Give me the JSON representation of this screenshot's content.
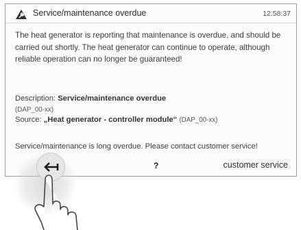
{
  "header": {
    "title": "Service/maintenance overdue",
    "time": "12:58:37",
    "icon": "warning-wrench-icon"
  },
  "message": "The heat generator is reporting that maintenance is overdue, and should be carried out shortly. The heat generator can continue to operate, although reliable operation can no longer be guaranteed!",
  "details": {
    "description_label": "Description:",
    "description_value": "Service/maintenance overdue",
    "description_code": "(DAP_00-xx)",
    "source_label": "Source:",
    "source_value": "„Heat generator - controller module“",
    "source_code": "(DAP_00-xx)"
  },
  "overdue_note": "Service/maintenance is long overdue. Please contact customer service!",
  "footer": {
    "back_icon": "back-arrow-icon",
    "help_label": "?",
    "service_label": "customer service"
  }
}
